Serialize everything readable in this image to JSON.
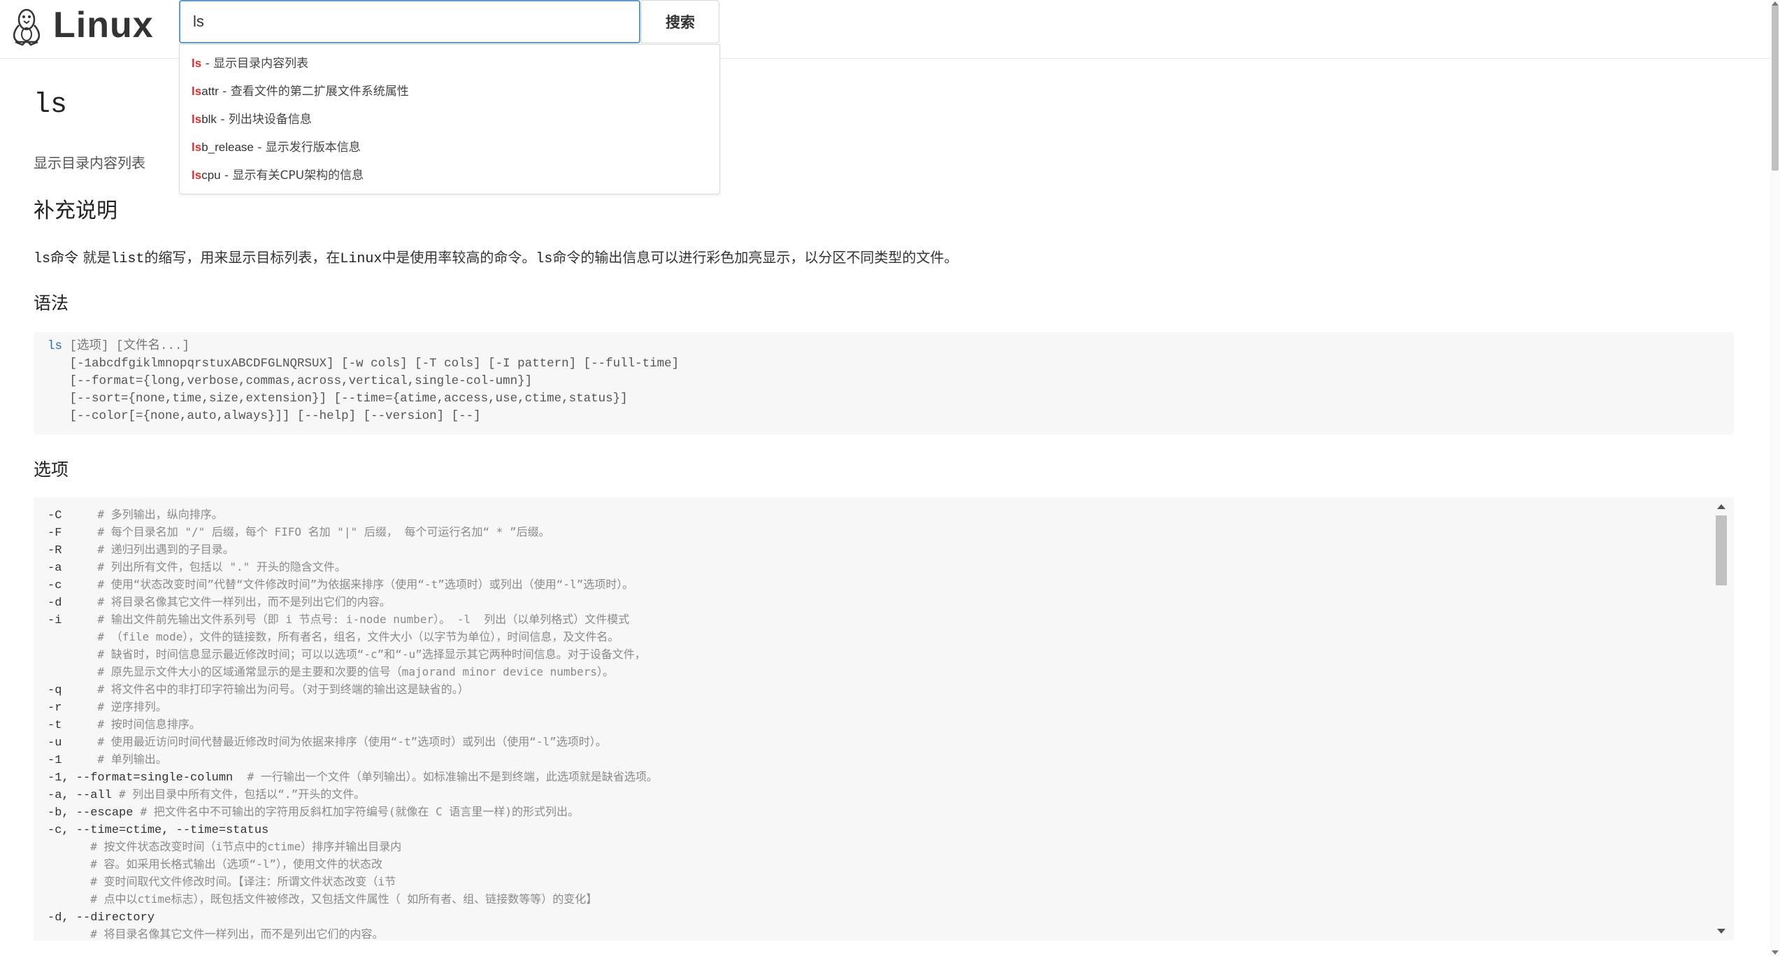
{
  "header": {
    "logo_text": "Linux",
    "search_value": "ls",
    "search_button": "搜索"
  },
  "suggestions": [
    {
      "highlight": "ls",
      "rest": "",
      "desc": " - 显示目录内容列表"
    },
    {
      "highlight": "ls",
      "rest": "attr",
      "desc": " - 查看文件的第二扩展文件系统属性"
    },
    {
      "highlight": "ls",
      "rest": "blk",
      "desc": " - 列出块设备信息"
    },
    {
      "highlight": "ls",
      "rest": "b_release",
      "desc": " - 显示发行版本信息"
    },
    {
      "highlight": "ls",
      "rest": "cpu",
      "desc": " - 显示有关CPU架构的信息"
    }
  ],
  "page": {
    "title": "ls",
    "subtitle": "显示目录内容列表",
    "section_supplement": "补充说明",
    "para_code1": "ls命令",
    "para_text1": " 就是",
    "para_code2": "list",
    "para_text2": "的缩写，用来显示目标列表，在",
    "para_code3": "Linux",
    "para_text3": "中是使用率较高的命令。",
    "para_code4": "ls",
    "para_text4": "命令的输出信息可以进行彩色加亮显示，以分区不同类型的文件。",
    "section_syntax": "语法",
    "section_options": "选项"
  },
  "syntax": {
    "cmd": "ls",
    "first_rest": " [选项] [文件名...]",
    "lines": [
      "   [-1abcdfgiklmnopqrstuxABCDFGLNQRSUX] [-w cols] [-T cols] [-I pattern] [--full-time]",
      "   [--format={long,verbose,commas,across,vertical,single-col-umn}]",
      "   [--sort={none,time,size,extension}] [--time={atime,access,use,ctime,status}]",
      "   [--color[={none,auto,always}]] [--help] [--version] [--]"
    ]
  },
  "options": [
    {
      "flag": "-C     ",
      "comment": "# 多列输出，纵向排序。"
    },
    {
      "flag": "-F     ",
      "comment": "# 每个目录名加 \"/\" 后缀，每个 FIFO 名加 \"|\" 后缀， 每个可运行名加“ * ”后缀。"
    },
    {
      "flag": "-R     ",
      "comment": "# 递归列出遇到的子目录。"
    },
    {
      "flag": "-a     ",
      "comment": "# 列出所有文件，包括以 \".\" 开头的隐含文件。"
    },
    {
      "flag": "-c     ",
      "comment": "# 使用“状态改变时间”代替“文件修改时间”为依据来排序（使用“-t”选项时）或列出（使用“-l”选项时）。"
    },
    {
      "flag": "-d     ",
      "comment": "# 将目录名像其它文件一样列出，而不是列出它们的内容。"
    },
    {
      "flag": "-i     ",
      "comment": "# 输出文件前先输出文件系列号（即 i 节点号: i-node number）。 -l  列出（以单列格式）文件模式"
    },
    {
      "flag": "       ",
      "comment": "# （file mode），文件的链接数，所有者名，组名，文件大小（以字节为单位），时间信息，及文件名。"
    },
    {
      "flag": "       ",
      "comment": "# 缺省时，时间信息显示最近修改时间；可以以选项“-c”和“-u”选择显示其它两种时间信息。对于设备文件，"
    },
    {
      "flag": "       ",
      "comment": "# 原先显示文件大小的区域通常显示的是主要和次要的信号（majorand minor device numbers）。"
    },
    {
      "flag": "-q     ",
      "comment": "# 将文件名中的非打印字符输出为问号。（对于到终端的输出这是缺省的。）"
    },
    {
      "flag": "-r     ",
      "comment": "# 逆序排列。"
    },
    {
      "flag": "-t     ",
      "comment": "# 按时间信息排序。"
    },
    {
      "flag": "-u     ",
      "comment": "# 使用最近访问时间代替最近修改时间为依据来排序（使用“-t”选项时）或列出（使用“-l”选项时）。"
    },
    {
      "flag": "-1     ",
      "comment": "# 单列输出。"
    },
    {
      "flag": "-1, --format=single-column  ",
      "comment": "# 一行输出一个文件（单列输出）。如标准输出不是到终端，此选项就是缺省选项。"
    },
    {
      "flag": "-a, --all ",
      "comment": "# 列出目录中所有文件，包括以“.”开头的文件。"
    },
    {
      "flag": "-b, --escape ",
      "comment": "# 把文件名中不可输出的字符用反斜杠加字符编号(就像在 C 语言里一样)的形式列出。"
    },
    {
      "flag": "-c, --time=ctime, --time=status",
      "comment": ""
    },
    {
      "flag": "      ",
      "comment": "# 按文件状态改变时间（i节点中的ctime）排序并输出目录内"
    },
    {
      "flag": "      ",
      "comment": "# 容。如采用长格式输出（选项“-l”），使用文件的状态改"
    },
    {
      "flag": "      ",
      "comment": "# 变时间取代文件修改时间。【译注：所谓文件状态改变（i节"
    },
    {
      "flag": "      ",
      "comment": "# 点中以ctime标志），既包括文件被修改，又包括文件属性（ 如所有者、组、链接数等等）的变化】"
    },
    {
      "flag": "-d, --directory",
      "comment": ""
    },
    {
      "flag": "      ",
      "comment": "# 将目录名像其它文件一样列出，而不是列出它们的内容。"
    }
  ]
}
